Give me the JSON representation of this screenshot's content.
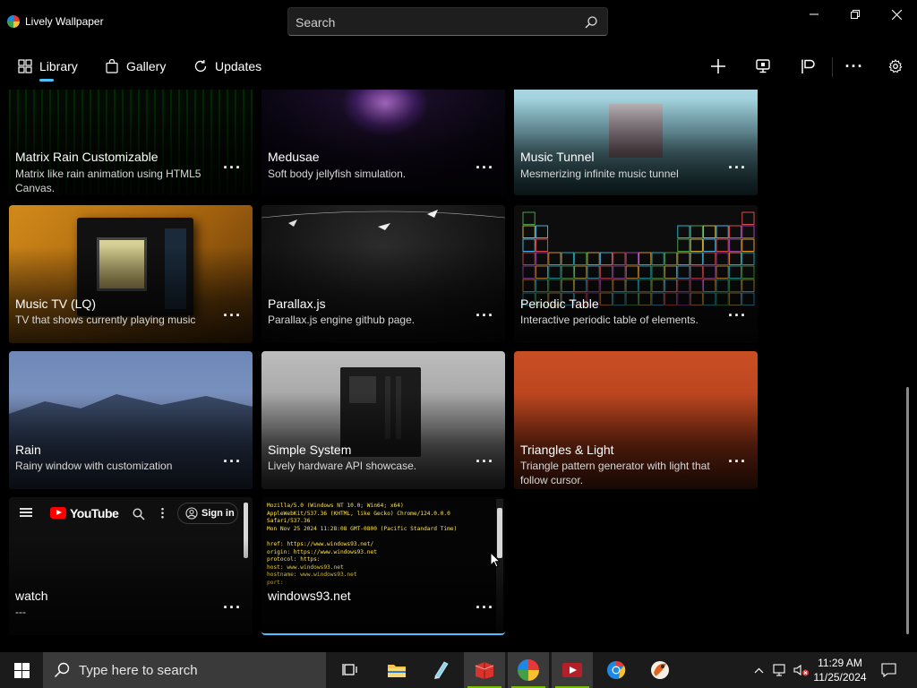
{
  "window": {
    "title": "Lively Wallpaper",
    "search_placeholder": "Search"
  },
  "nav": {
    "library": "Library",
    "gallery": "Gallery",
    "updates": "Updates",
    "more": "···"
  },
  "cards": [
    {
      "title": "Matrix Rain Customizable",
      "desc": "Matrix like rain animation using HTML5 Canvas.",
      "more": "···"
    },
    {
      "title": "Medusae",
      "desc": "Soft body jellyfish simulation.",
      "more": "···"
    },
    {
      "title": "Music Tunnel",
      "desc": "Mesmerizing infinite music tunnel",
      "more": "···"
    },
    {
      "title": "Music TV (LQ)",
      "desc": "TV that shows currently playing music",
      "more": "···"
    },
    {
      "title": "Parallax.js",
      "desc": "Parallax.js engine github page.",
      "more": "···"
    },
    {
      "title": "Periodic Table",
      "desc": "Interactive periodic table of elements.",
      "more": "···"
    },
    {
      "title": "Rain",
      "desc": "Rainy window with customization",
      "more": "···"
    },
    {
      "title": "Simple System",
      "desc": "Lively hardware API showcase.",
      "more": "···"
    },
    {
      "title": "Triangles & Light",
      "desc": "Triangle pattern generator with light that follow cursor.",
      "more": "···"
    },
    {
      "title": "watch",
      "desc": "---",
      "more": "···"
    },
    {
      "title": "windows93.net",
      "desc": "",
      "more": "···"
    }
  ],
  "youtube_preview": {
    "logo_text": "YouTube",
    "signin": "Sign in"
  },
  "windows93_preview": {
    "lines": [
      "Mozilla/5.0 (Windows NT 10.0; Win64; x64)",
      "AppleWebKit/537.36 (KHTML, like Gecko) Chrome/124.0.0.0",
      "Safari/537.36",
      "Mon Nov 25 2024 11:28:08 GMT-0800 (Pacific Standard Time)",
      "",
      "href: https://www.windows93.net/",
      "origin: https://www.windows93.net",
      "protocol: https:",
      "host: www.windows93.net",
      "hostname: www.windows93.net",
      "port:"
    ]
  },
  "taskbar": {
    "search_placeholder": "Type here to search",
    "time": "11:29 AM",
    "date": "11/25/2024"
  },
  "colors": {
    "accent": "#4cc2ff",
    "taskbar": "#1b1b1b",
    "terminal_text": "#ffe34d"
  }
}
